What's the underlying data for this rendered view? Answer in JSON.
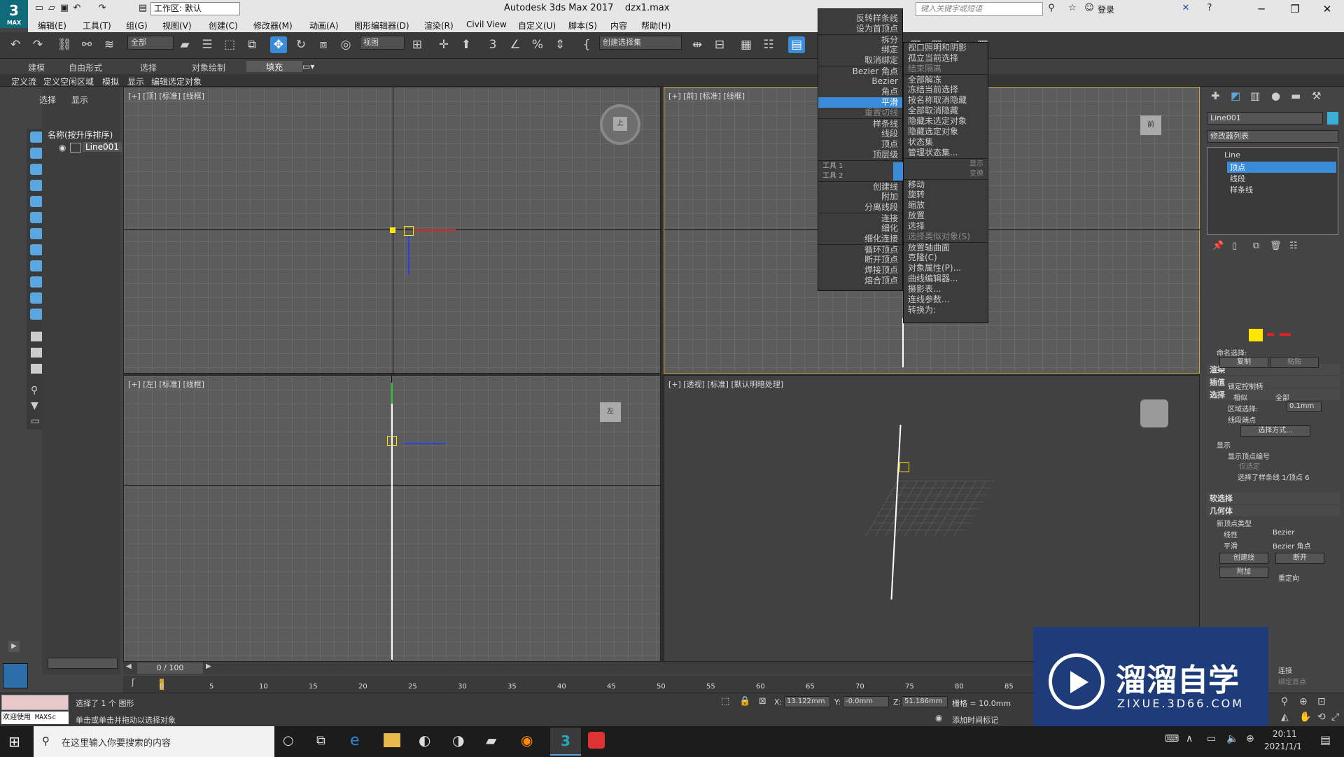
{
  "app": {
    "logo_text": "3",
    "logo_sub": "MAX",
    "title": "Autodesk 3ds Max 2017",
    "filename": "dzx1.max",
    "workspace": "工作区: 默认",
    "search_placeholder": "键入关键字或短语",
    "login": "登录"
  },
  "menus": [
    "编辑(E)",
    "工具(T)",
    "组(G)",
    "视图(V)",
    "创建(C)",
    "修改器(M)",
    "动画(A)",
    "图形编辑器(D)",
    "渲染(R)",
    "Civil View",
    "自定义(U)",
    "脚本(S)",
    "内容",
    "帮助(H)"
  ],
  "toolbar": {
    "filter": "全部",
    "refcoord": "视图",
    "named_set": "创建选择集"
  },
  "ribbon": {
    "tabs": [
      "建模",
      "自由形式",
      "选择",
      "对象绘制",
      "填充"
    ],
    "sub": [
      "定义流",
      "定义空闲区域",
      "模拟",
      "显示",
      "编辑选定对象"
    ]
  },
  "explorer": {
    "tabs": [
      "选择",
      "显示"
    ],
    "column": "名称(按升序排序)",
    "item": "Line001"
  },
  "viewports": {
    "top": "[+] [顶] [标准] [线框]",
    "front": "[+] [前] [标准] [线框]",
    "left": "[+] [左] [标准] [线框]",
    "persp": "[+] [透视] [标准] [默认明暗处理]",
    "cube_top": "上",
    "cube_front": "前",
    "cube_left": "左"
  },
  "quad_left": [
    {
      "t": "反转样条线"
    },
    {
      "t": "设为首顶点"
    },
    {
      "t": "拆分"
    },
    {
      "t": "绑定"
    },
    {
      "t": "取消绑定"
    },
    {
      "t": "Bezier 角点"
    },
    {
      "t": "Bezier"
    },
    {
      "t": "角点"
    },
    {
      "t": "平滑",
      "hl": true
    },
    {
      "t": "重置切线",
      "gray": true
    },
    {
      "t": "样条线"
    },
    {
      "t": "线段"
    },
    {
      "t": "顶点"
    },
    {
      "t": "顶层级"
    },
    {
      "t": "工具 1"
    },
    {
      "t": "工具 2"
    },
    {
      "t": "创建线"
    },
    {
      "t": "附加"
    },
    {
      "t": "分离线段"
    },
    {
      "t": "连接"
    },
    {
      "t": "细化"
    },
    {
      "t": "细化连接"
    },
    {
      "t": "循环顶点"
    },
    {
      "t": "断开顶点"
    },
    {
      "t": "焊接顶点"
    },
    {
      "t": "熔合顶点"
    }
  ],
  "quad_right": [
    {
      "t": "视口照明和阴影"
    },
    {
      "t": "孤立当前选择"
    },
    {
      "t": "结束隔离",
      "gray": true
    },
    {
      "t": "全部解冻"
    },
    {
      "t": "冻结当前选择"
    },
    {
      "t": "按名称取消隐藏"
    },
    {
      "t": "全部取消隐藏"
    },
    {
      "t": "隐藏未选定对象"
    },
    {
      "t": "隐藏选定对象"
    },
    {
      "t": "状态集"
    },
    {
      "t": "管理状态集..."
    },
    {
      "t": "显示",
      "gray": true
    },
    {
      "t": "变换",
      "gray": true
    },
    {
      "t": "移动"
    },
    {
      "t": "旋转"
    },
    {
      "t": "缩放"
    },
    {
      "t": "放置"
    },
    {
      "t": "选择"
    },
    {
      "t": "选择类似对象(S)",
      "gray": true
    },
    {
      "t": "放置轴曲面"
    },
    {
      "t": "克隆(C)"
    },
    {
      "t": "对象属性(P)..."
    },
    {
      "t": "曲线编辑器..."
    },
    {
      "t": "摄影表..."
    },
    {
      "t": "连线参数..."
    },
    {
      "t": "转换为:"
    }
  ],
  "cmd": {
    "objname": "Line001",
    "modlist": "修改器列表",
    "stack": [
      "Line",
      "顶点",
      "线段",
      "样条线"
    ],
    "rollouts": [
      "渲染",
      "插值",
      "选择"
    ],
    "named_sel": "命名选择:",
    "copy": "复制",
    "paste": "粘贴",
    "lock_handles": "锁定控制柄",
    "similar": "相似",
    "all": "全部",
    "area_sel": "区域选择:",
    "area_val": "0.1mm",
    "seg_end": "线段端点",
    "select_by": "选择方式...",
    "display": "显示",
    "show_vnum": "显示顶点编号",
    "only_sel": "仅选定",
    "sel_info": "选择了样条线 1/顶点 6",
    "soft_sel": "软选择",
    "geometry": "几何体",
    "new_vtype": "新顶点类型",
    "linear": "线性",
    "bezier": "Bezier",
    "smooth": "平滑",
    "bezier_corner": "Bezier 角点",
    "create_line": "创建线",
    "break": "断开",
    "attach": "附加",
    "reorient": "重定向",
    "connect": "连接",
    "bind_first": "绑定首点"
  },
  "timeline": {
    "frame": "0 / 100",
    "ticks": [
      "0",
      "5",
      "10",
      "15",
      "20",
      "25",
      "30",
      "35",
      "40",
      "45",
      "50",
      "55",
      "60",
      "65",
      "70",
      "75",
      "80",
      "85"
    ]
  },
  "status": {
    "welcome": "欢迎使用 MAXSc",
    "selected": "选择了 1 个 图形",
    "prompt": "单击或单击并拖动以选择对象",
    "x_label": "X:",
    "x": "13.122mm",
    "y_label": "Y:",
    "y": "-0.0mm",
    "z_label": "Z:",
    "z": "51.186mm",
    "grid": "栅格 = 10.0mm",
    "addtime": "添加时间标记"
  },
  "taskbar": {
    "search": "在这里输入你要搜索的内容",
    "time": "20:11",
    "date": "2021/1/1"
  },
  "watermark": {
    "brand": "溜溜自学",
    "url": "ZIXUE.3D66.COM"
  }
}
